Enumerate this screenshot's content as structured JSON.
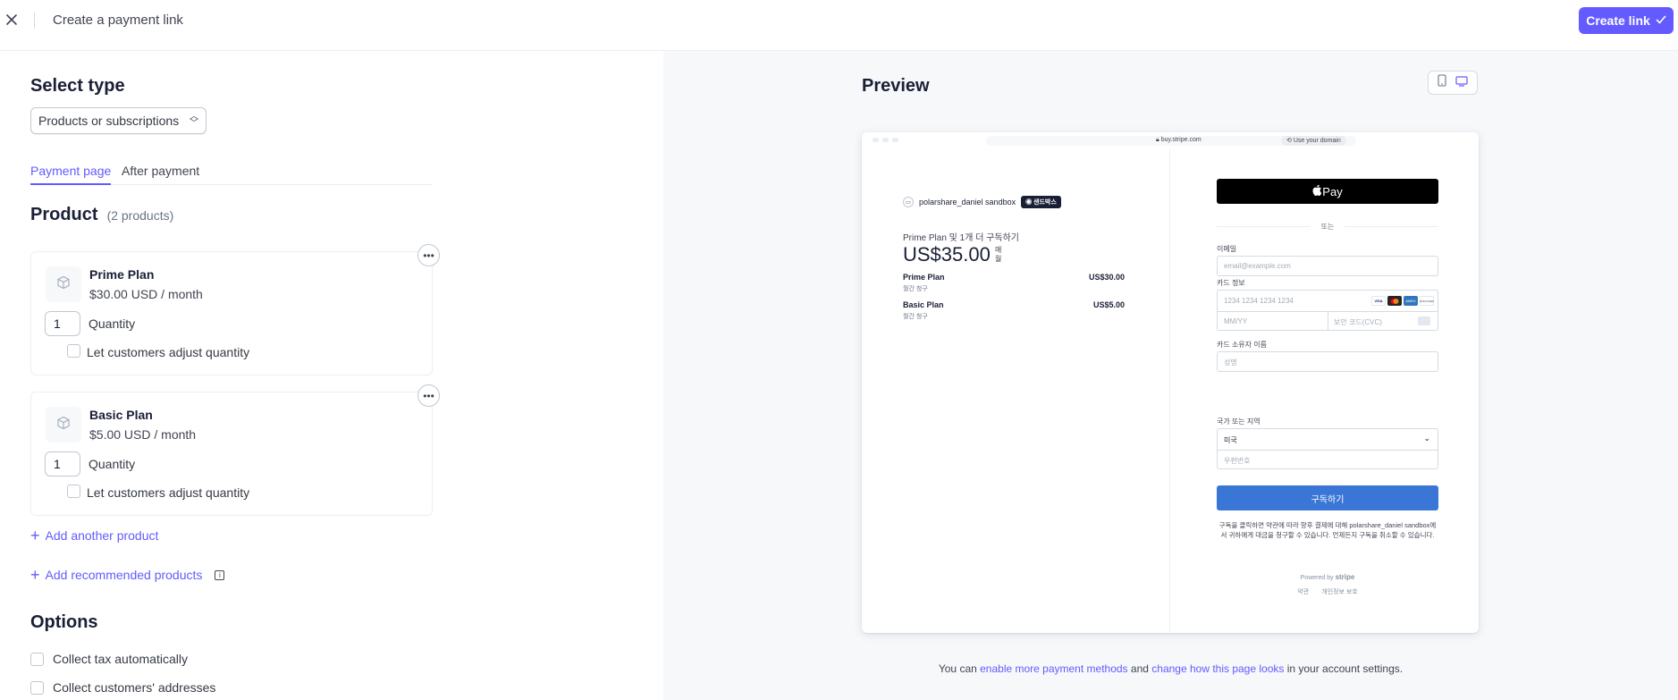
{
  "topbar": {
    "title": "Create a payment link",
    "create_label": "Create link"
  },
  "left": {
    "select_type_heading": "Select type",
    "type_value": "Products or subscriptions",
    "tabs": [
      {
        "label": "Payment page",
        "active": true
      },
      {
        "label": "After payment",
        "active": false
      }
    ],
    "product_heading": "Product",
    "product_count": "(2 products)",
    "products": [
      {
        "name": "Prime Plan",
        "price": "$30.00 USD / month",
        "quantity": "1",
        "quantity_label": "Quantity",
        "adjust_label": "Let customers adjust quantity",
        "adjust_checked": false
      },
      {
        "name": "Basic Plan",
        "price": "$5.00 USD / month",
        "quantity": "1",
        "quantity_label": "Quantity",
        "adjust_label": "Let customers adjust quantity",
        "adjust_checked": false
      }
    ],
    "add_another": "Add another product",
    "add_recommended": "Add recommended products",
    "options_heading": "Options",
    "options": [
      {
        "label": "Collect tax automatically",
        "checked": false
      },
      {
        "label": "Collect customers' addresses",
        "checked": false
      }
    ]
  },
  "preview": {
    "heading": "Preview",
    "device_modes": [
      {
        "icon": "mobile-icon",
        "active": false
      },
      {
        "icon": "desktop-icon",
        "active": true
      }
    ],
    "browser": {
      "url": "buy.stripe.com",
      "use_domain": "Use your domain"
    },
    "checkout": {
      "merchant": "polarshare_daniel sandbox",
      "sandbox_badge": "샌드박스",
      "subtitle": "Prime Plan 및 1개 더 구독하기",
      "total": "US$35.00",
      "per": "매 월",
      "line_items": [
        {
          "name": "Prime Plan",
          "sub": "월간 청구",
          "amount": "US$30.00"
        },
        {
          "name": "Basic Plan",
          "sub": "월간 청구",
          "amount": "US$5.00"
        }
      ],
      "apple_pay": "Pay",
      "or": "또는",
      "email_label": "이메일",
      "email_placeholder": "email@example.com",
      "card_label": "카드 정보",
      "card_number_placeholder": "1234 1234 1234 1234",
      "card_brands": [
        "VISA",
        "MC",
        "AMEX",
        "DISCOVER"
      ],
      "expiry_placeholder": "MM/YY",
      "cvc_placeholder": "보안 코드(CVC)",
      "holder_label": "카드 소유자 이름",
      "holder_placeholder": "성명",
      "country_label": "국가 또는 지역",
      "country_value": "미국",
      "zip_placeholder": "우편번호",
      "subscribe_button": "구독하기",
      "legal_text": "구독을 클릭하면 약관에 따라 향후 결제에 대해 polarshare_daniel sandbox에서 귀하에게 대금을 청구할 수 있습니다. 언제든지 구독을 취소할 수 있습니다.",
      "powered_by": "Powered by",
      "stripe_word": "stripe",
      "footer_links": [
        "약관",
        "개인정보 보호"
      ]
    },
    "footnote": {
      "pre": "You can ",
      "link1": "enable more payment methods",
      "mid": " and ",
      "link2": "change how this page looks",
      "post": " in your account settings."
    }
  },
  "colors": {
    "accent": "#635bff",
    "subscribe": "#3a76d6",
    "preview_bg": "#f6f8fa"
  }
}
